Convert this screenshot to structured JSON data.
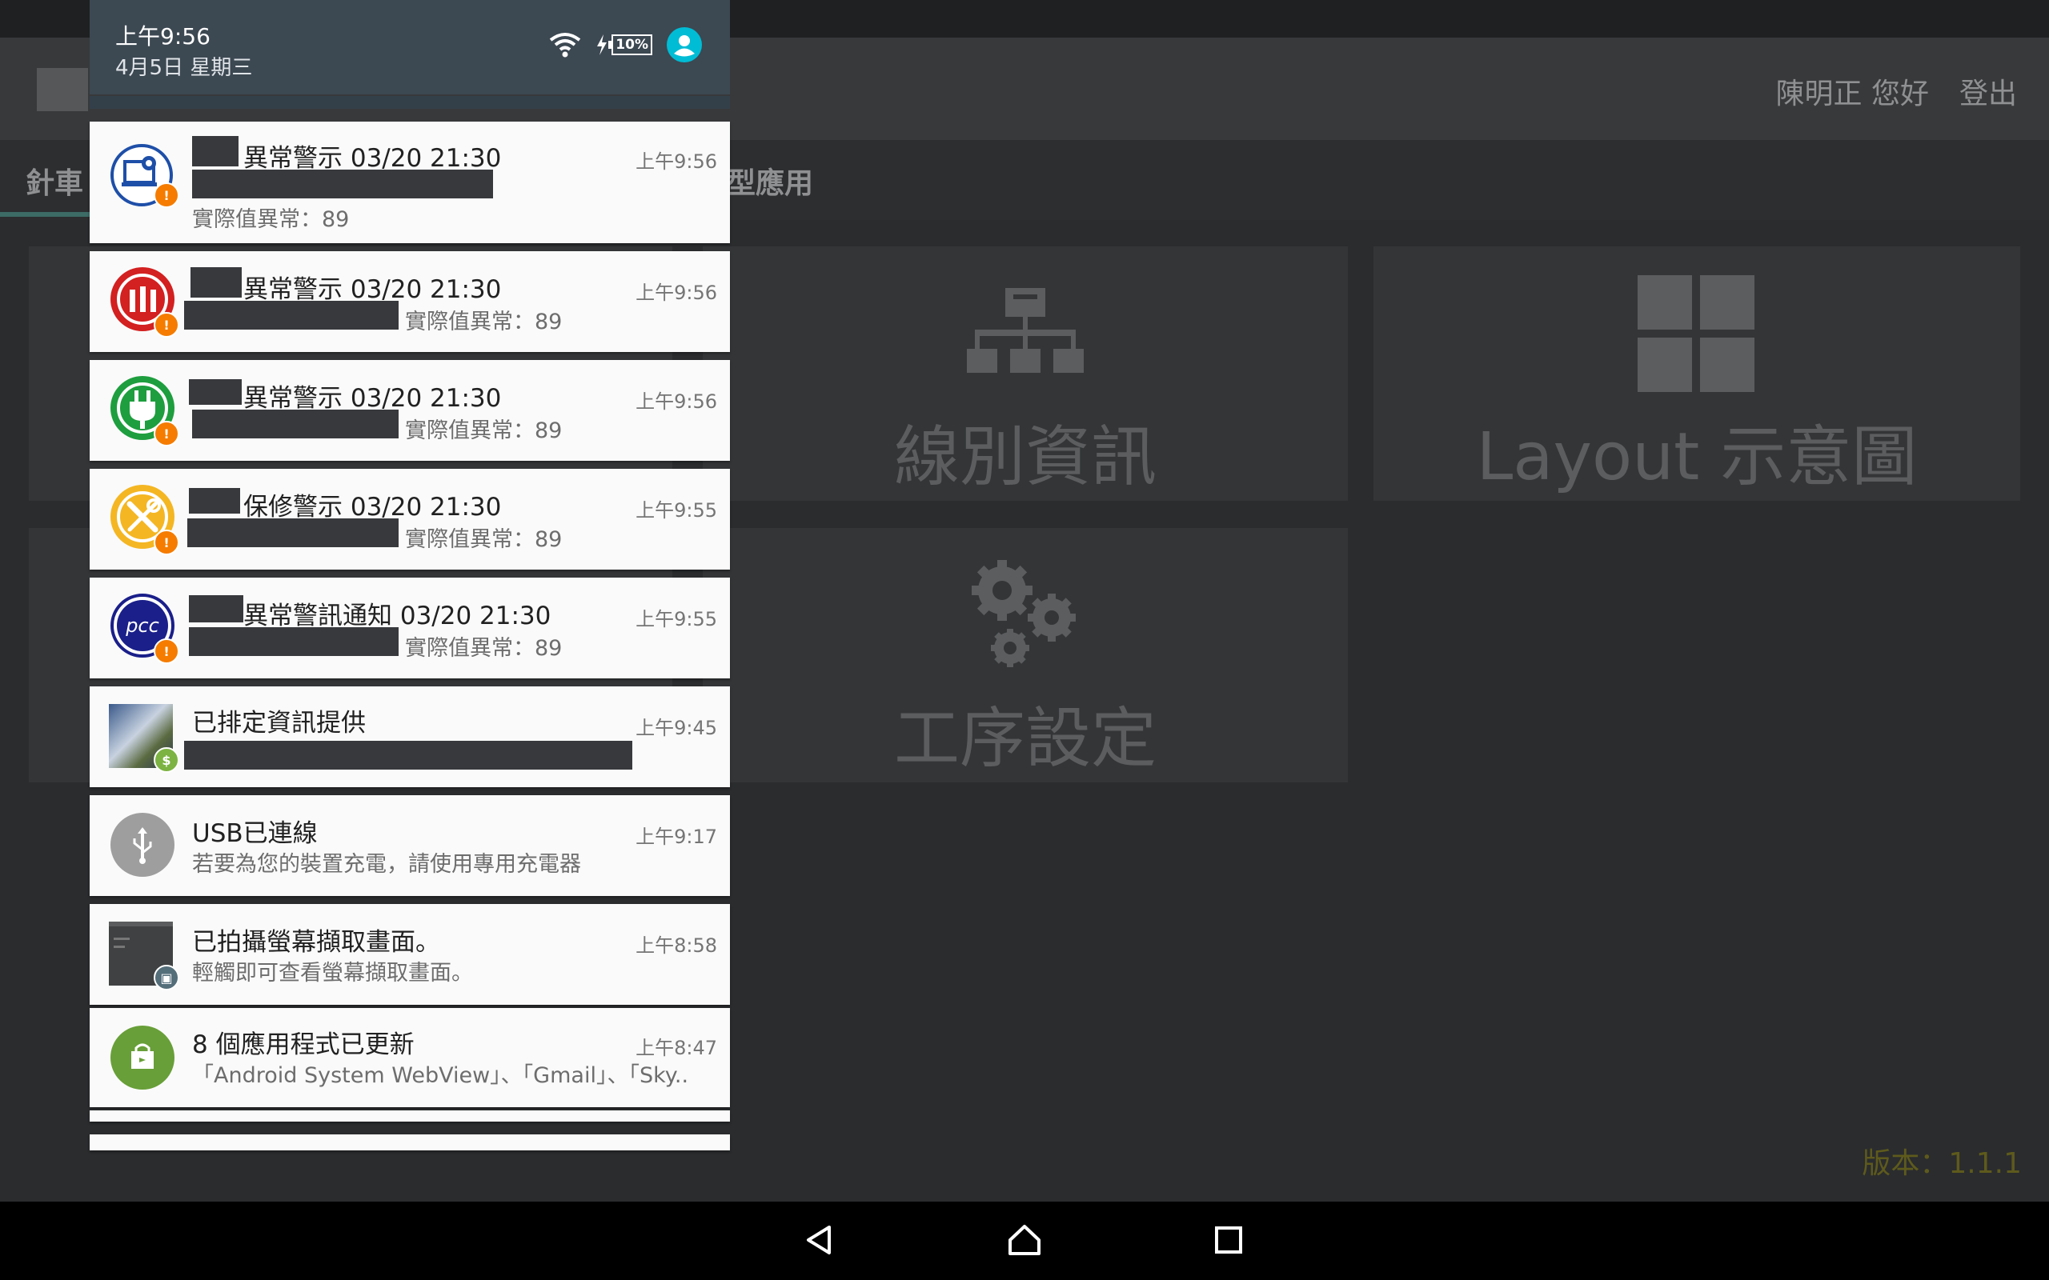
{
  "app": {
    "greeting": "陳明正 您好",
    "logout": "登出",
    "tabs": [
      "針車",
      "型應用"
    ],
    "tiles": [
      {
        "label": "線別資訊",
        "icon": "network-hierarchy-icon"
      },
      {
        "label": "Layout 示意圖",
        "icon": "grid-layout-icon"
      },
      {
        "label": "工序設定",
        "icon": "gears-icon"
      }
    ],
    "version": "版本：1.1.1"
  },
  "status": {
    "time": "上午9:56",
    "date": "4月5日 星期三",
    "battery": "10%"
  },
  "notifications": [
    {
      "title": "異常警示 03/20 21:30",
      "text": "實際值異常：89",
      "time": "上午9:56",
      "icon": "computer-gear-icon",
      "color": "#1e4fa8"
    },
    {
      "title": "異常警示 03/20 21:30",
      "text": "實際值異常：89",
      "time": "上午9:56",
      "icon": "machine-alert-icon",
      "color": "#d32020"
    },
    {
      "title": "異常警示 03/20 21:30",
      "text": "實際值異常：89",
      "time": "上午9:56",
      "icon": "power-plug-icon",
      "color": "#1e9e3e"
    },
    {
      "title": "保修警示 03/20 21:30",
      "text": "實際值異常：89",
      "time": "上午9:55",
      "icon": "wrench-screwdriver-icon",
      "color": "#f4b622"
    },
    {
      "title": "異常警訊通知 03/20 21:30",
      "text": "實際值異常：89",
      "time": "上午9:55",
      "icon": "pcc-logo-icon",
      "color": "#1a1f8a"
    },
    {
      "title": "已排定資訊提供",
      "text": "",
      "time": "上午9:45",
      "icon": "photo-thumbnail-icon",
      "color": "#7cb342"
    },
    {
      "title": "USB已連線",
      "text": "若要為您的裝置充電，請使用專用充電器",
      "time": "上午9:17",
      "icon": "usb-icon",
      "color": "#9e9e9e"
    },
    {
      "title": "已拍攝螢幕擷取畫面。",
      "text": "輕觸即可查看螢幕擷取畫面。",
      "time": "上午8:58",
      "icon": "screenshot-thumbnail-icon",
      "color": "#546e7a"
    },
    {
      "title": "8 個應用程式已更新",
      "text": "「Android System WebView」、「Gmail」、「Sky..",
      "time": "上午8:47",
      "icon": "play-store-bag-icon",
      "color": "#689f38"
    }
  ]
}
